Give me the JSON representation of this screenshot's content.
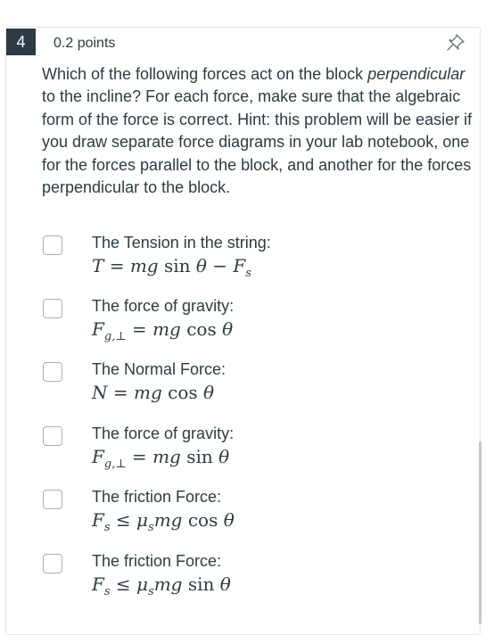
{
  "question": {
    "number": "4",
    "points": "0.2 points",
    "text_part1": "Which of the following forces act on the block ",
    "text_emphasis": "perpendicular",
    "text_part2": " to the incline? For each force, make sure that the algebraic form of the force is correct. Hint: this problem will be easier if you draw separate force diagrams in your lab notebook, one for the forces parallel to the block, and another for the forces perpendicular to the block."
  },
  "options": [
    {
      "label": "The Tension in the string:",
      "formula": "T = mg sin θ − F_s",
      "checked": false
    },
    {
      "label": "The force of gravity:",
      "formula": "F_g,⊥ = mg cos θ",
      "checked": false
    },
    {
      "label": "The Normal Force:",
      "formula": "N = mg cos θ",
      "checked": false
    },
    {
      "label": "The force of gravity:",
      "formula": "F_g,⊥ = mg sin θ",
      "checked": false
    },
    {
      "label": "The friction Force:",
      "formula": "F_s ≤ μ_s mg cos θ",
      "checked": false
    },
    {
      "label": "The friction Force:",
      "formula": "F_s ≤ μ_s mg sin θ",
      "checked": false
    }
  ],
  "icons": {
    "pin": "pin-icon"
  },
  "colors": {
    "text": "#2d3b45",
    "badge": "#2d3b45",
    "checkbox_border": "#a8b0b6"
  }
}
